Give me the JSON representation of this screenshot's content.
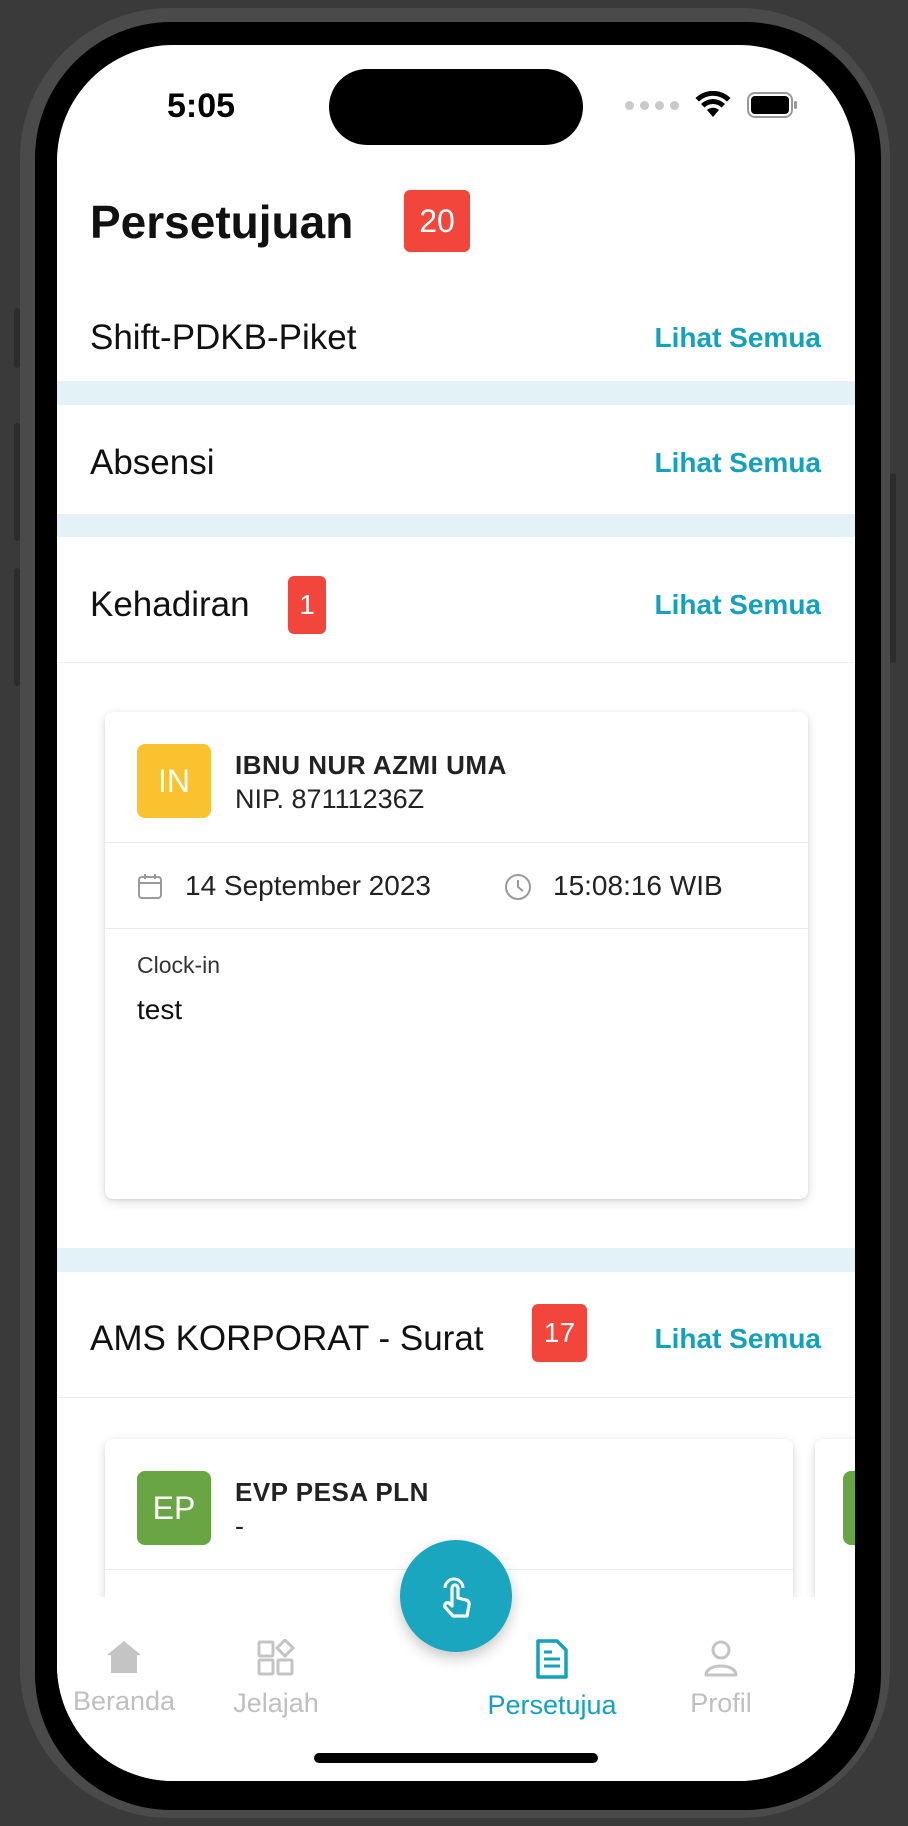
{
  "status_bar": {
    "time": "5:05"
  },
  "header": {
    "title": "Persetujuan",
    "badge": "20"
  },
  "sections": [
    {
      "title": "Shift-PDKB-Piket",
      "see_all": "Lihat Semua"
    },
    {
      "title": "Absensi",
      "see_all": "Lihat Semua"
    },
    {
      "title": "Kehadiran",
      "badge": "1",
      "see_all": "Lihat Semua"
    },
    {
      "title": "AMS KORPORAT - Surat",
      "badge": "17",
      "see_all": "Lihat Semua"
    }
  ],
  "kehadiran_card": {
    "initials": "IN",
    "name": "IBNU NUR AZMI UMA",
    "nip": "NIP. 87111236Z",
    "date": "14 September 2023",
    "time": "15:08:16 WIB",
    "note_label": "Clock-in",
    "note": "test",
    "avatar_color": "#f9c22e"
  },
  "surat_card": {
    "initials": "EP",
    "name": "EVP PESA PLN",
    "subtitle": "-",
    "avatar_color": "#6aa544"
  },
  "tabbar": {
    "items": [
      {
        "label": "Beranda",
        "icon": "home-icon"
      },
      {
        "label": "Jelajah",
        "icon": "grid-icon"
      },
      {
        "label": "Persetujua",
        "icon": "document-icon",
        "active": true
      },
      {
        "label": "Profil",
        "icon": "person-icon"
      }
    ],
    "fab_icon": "tap-hand-icon"
  },
  "colors": {
    "accent": "#14a1bc",
    "badge": "#f2463c",
    "separator": "#e3f2f6"
  }
}
